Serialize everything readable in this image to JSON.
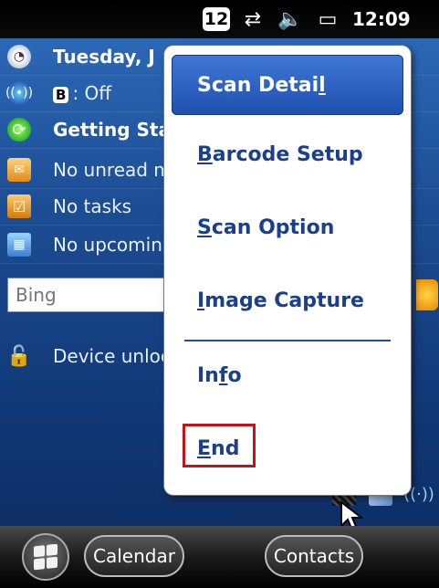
{
  "status_bar": {
    "notification_count": "12",
    "icons": [
      "sync-icon",
      "volume-icon",
      "battery-charging-icon"
    ],
    "time": "12:09"
  },
  "today": {
    "date": "Tuesday, J",
    "bluetooth_badge": "B",
    "bluetooth_status": ": Off",
    "getting_started": "Getting Sta",
    "messages": "No unread m",
    "tasks": "No tasks",
    "calendar": "No upcoming",
    "search_placeholder": "Bing",
    "device_lock": "Device unloc"
  },
  "menu": {
    "items": [
      {
        "label_pre": "Scan Detai",
        "label_ul": "l",
        "label_post": ""
      },
      {
        "label_pre": "",
        "label_ul": "B",
        "label_post": "arcode Setup"
      },
      {
        "label_pre": "",
        "label_ul": "S",
        "label_post": "can Option"
      },
      {
        "label_pre": "",
        "label_ul": "I",
        "label_post": "mage Capture"
      },
      {
        "label_pre": "In",
        "label_ul": "f",
        "label_post": "o"
      },
      {
        "label_pre": "",
        "label_ul": "E",
        "label_post": "nd"
      }
    ],
    "selected_index": 0,
    "highlighted_item": "End"
  },
  "softkeys": {
    "left": "Calendar",
    "right": "Contacts"
  },
  "colors": {
    "menu_selection": "#2a5fc0",
    "menu_text": "#1c3f8a",
    "highlight_box": "#c0141a"
  }
}
